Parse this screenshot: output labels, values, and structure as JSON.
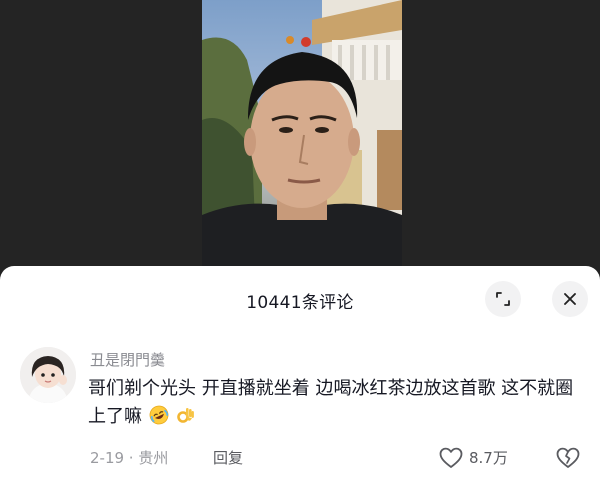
{
  "comments_panel": {
    "title": "10441条评论"
  },
  "comment": {
    "username": "丑是閉門羹",
    "text": "哥们剃个光头 开直播就坐着 边喝冰红茶边放这首歌 这不就圈上了嘛",
    "emojis": [
      "rolling-laughing-emoji",
      "ok-hand-emoji"
    ],
    "date_location": "2-19 · 贵州",
    "reply_label": "回复",
    "like_count": "8.7万"
  },
  "icons": {
    "expand": "expand-icon",
    "close": "close-icon",
    "like": "heart-icon",
    "dislike": "broken-heart-icon"
  },
  "colors": {
    "sheet_background": "#ffffff",
    "backdrop": "#242424",
    "primary_text": "#161823",
    "secondary_text": "#8a8b91"
  }
}
